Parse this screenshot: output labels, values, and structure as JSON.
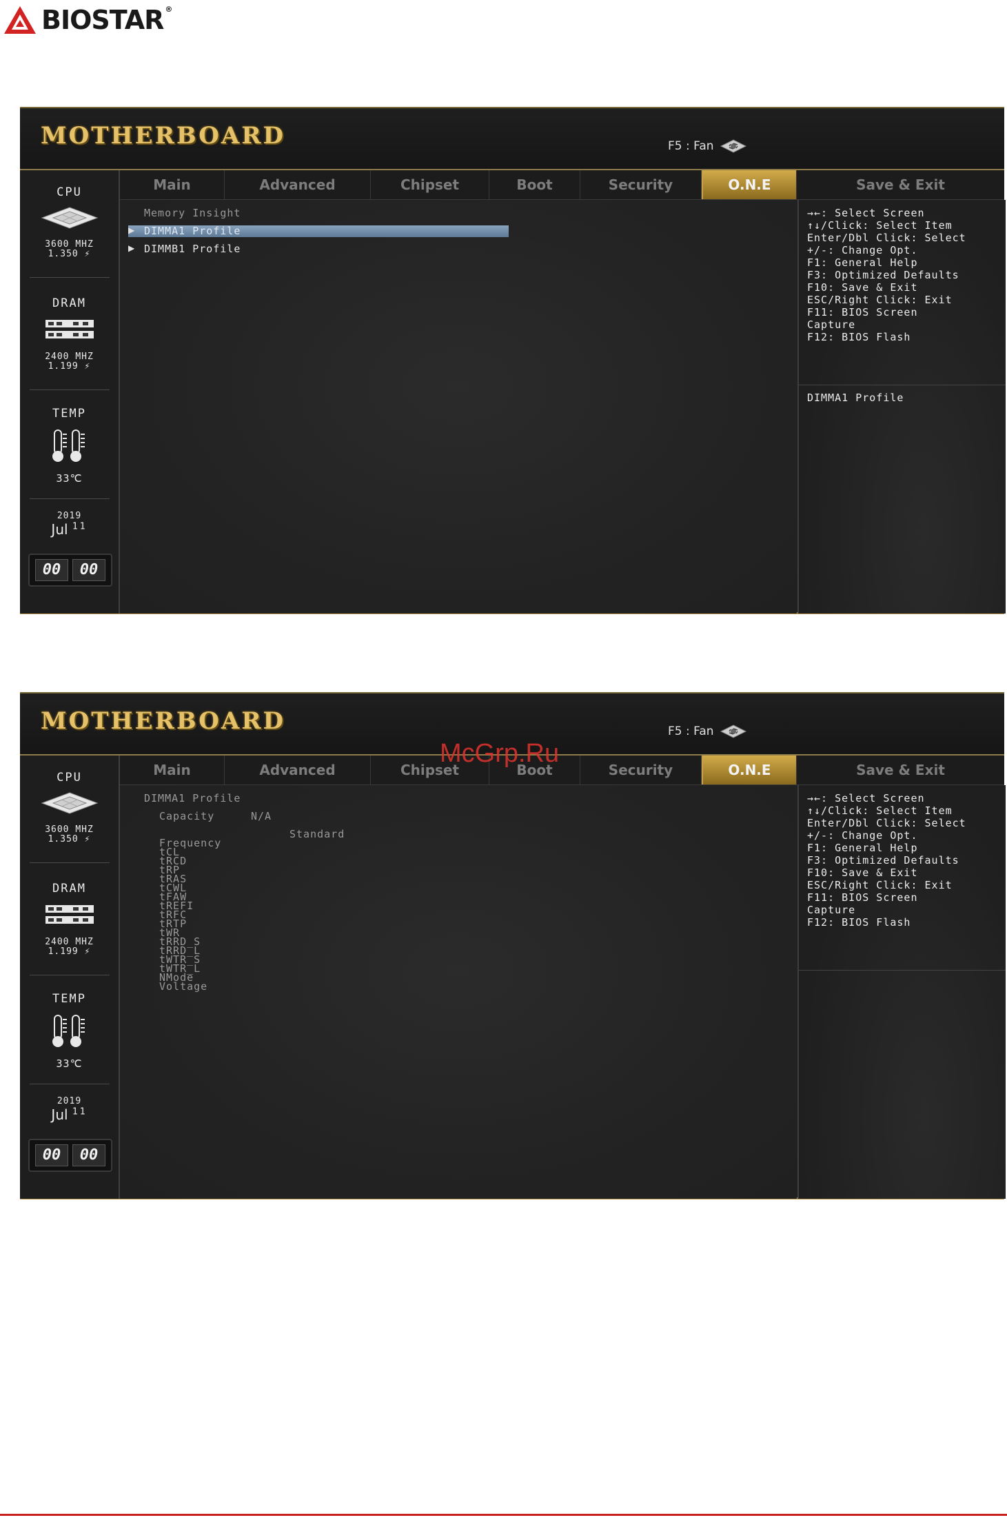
{
  "brand": {
    "name": "BIOSTAR",
    "mark": "®"
  },
  "watermark": "McGrp.Ru",
  "screens": [
    {
      "header": {
        "title": "MOTHERBOARD",
        "fan": "F5 : Fan"
      },
      "left": {
        "cpu": {
          "title": "CPU",
          "freq": "3600 MHZ",
          "volt": "1.350 ⚡"
        },
        "dram": {
          "title": "DRAM",
          "freq": "2400 MHZ",
          "volt": "1.199 ⚡"
        },
        "temp": {
          "title": "TEMP",
          "value": "33℃"
        },
        "date": {
          "year": "2019",
          "month": "Jul",
          "day": "11"
        },
        "clock": {
          "h": "00",
          "m": "00"
        }
      },
      "tabs": [
        "Main",
        "Advanced",
        "Chipset",
        "Boot",
        "Security",
        "O.N.E",
        "Save & Exit"
      ],
      "active_tab": "O.N.E",
      "content": {
        "heading": "Memory Insight",
        "items": [
          "DIMMA1 Profile",
          "DIMMB1 Profile"
        ]
      },
      "help": {
        "keys": [
          "→←: Select Screen",
          "↑↓/Click: Select Item",
          "Enter/Dbl Click: Select",
          "+/-: Change Opt.",
          "F1: General Help",
          "F3: Optimized Defaults",
          "F10: Save & Exit",
          "ESC/Right Click: Exit",
          "F11: BIOS Screen",
          "Capture",
          "F12: BIOS Flash"
        ],
        "description": "DIMMA1 Profile"
      }
    },
    {
      "header": {
        "title": "MOTHERBOARD",
        "fan": "F5 : Fan"
      },
      "left": {
        "cpu": {
          "title": "CPU",
          "freq": "3600 MHZ",
          "volt": "1.350 ⚡"
        },
        "dram": {
          "title": "DRAM",
          "freq": "2400 MHZ",
          "volt": "1.199 ⚡"
        },
        "temp": {
          "title": "TEMP",
          "value": "33℃"
        },
        "date": {
          "year": "2019",
          "month": "Jul",
          "day": "11"
        },
        "clock": {
          "h": "00",
          "m": "00"
        }
      },
      "tabs": [
        "Main",
        "Advanced",
        "Chipset",
        "Boot",
        "Security",
        "O.N.E",
        "Save & Exit"
      ],
      "active_tab": "O.N.E",
      "content": {
        "heading": "DIMMA1 Profile",
        "capacity_label": "Capacity",
        "capacity_value": "N/A",
        "column_header": "Standard",
        "rows": [
          "Frequency",
          "tCL",
          "tRCD",
          "tRP",
          "tRAS",
          "tCWL",
          "tFAW",
          "tREFI",
          "tRFC",
          "tRTP",
          "tWR",
          "tRRD_S",
          "tRRD_L",
          "tWTR_S",
          "tWTR_L",
          "NMode",
          "Voltage"
        ]
      },
      "help": {
        "keys": [
          "→←: Select Screen",
          "↑↓/Click: Select Item",
          "Enter/Dbl Click: Select",
          "+/-: Change Opt.",
          "F1: General Help",
          "F3: Optimized Defaults",
          "F10: Save & Exit",
          "ESC/Right Click: Exit",
          "F11: BIOS Screen",
          "Capture",
          "F12: BIOS Flash"
        ],
        "description": ""
      }
    }
  ]
}
